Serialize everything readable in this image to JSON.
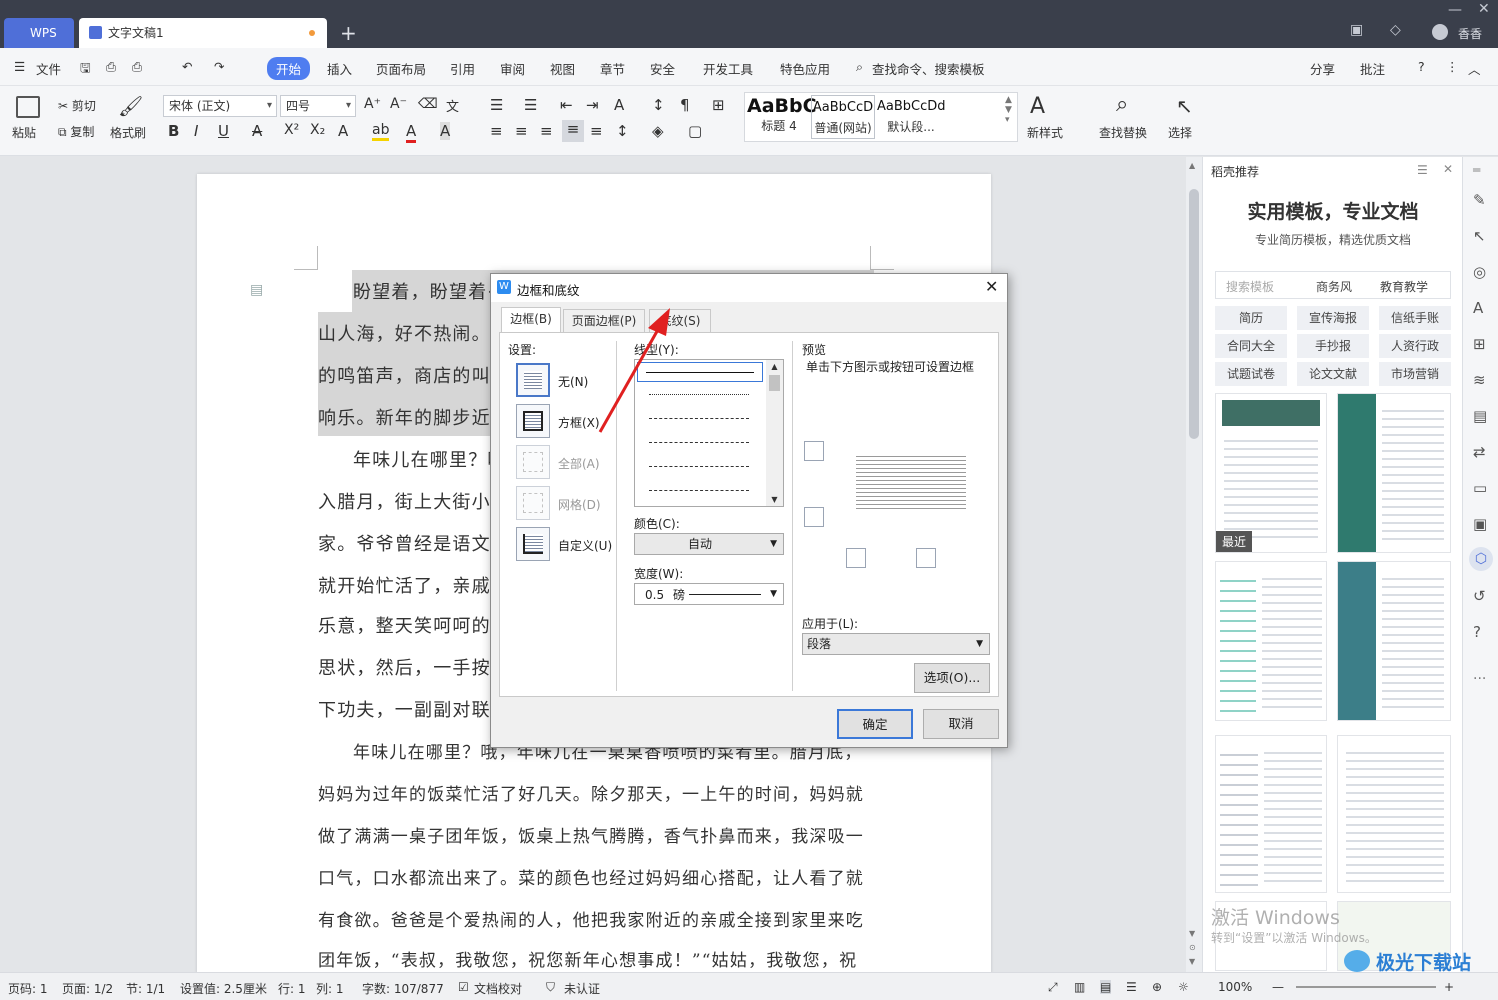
{
  "titlebar": {
    "wps_tab": "WPS",
    "doc_tab": "文字文稿1",
    "new_tab": "+",
    "user": "香香"
  },
  "menubar": {
    "file": "文件",
    "items": [
      "开始",
      "插入",
      "页面布局",
      "引用",
      "审阅",
      "视图",
      "章节",
      "安全",
      "开发工具",
      "特色应用"
    ],
    "search": "查找命令、搜索模板",
    "share": "分享",
    "comment": "批注"
  },
  "ribbon": {
    "paste": "粘贴",
    "cut": "剪切",
    "copy": "复制",
    "format_painter": "格式刷",
    "font_name": "宋体 (正文)",
    "font_size": "四号",
    "styles": [
      {
        "sample": "AaBbC",
        "name": "标题 4"
      },
      {
        "sample": "AaBbCcD",
        "name": "普通(网站)"
      },
      {
        "sample": "AaBbCcDd",
        "name": "默认段..."
      }
    ],
    "new_style": "新样式",
    "find_replace": "查找替换",
    "select": "选择"
  },
  "document": {
    "lines": [
      "盼望着，盼望着·",
      "山人海，好不热闹。眼",
      "的鸣笛声，商店的叫卖",
      "响乐。新年的脚步近",
      "年味儿在哪里？哦",
      "入腊月，街上大街小巷",
      "家。爷爷曾经是语文老",
      "就开始忙活了，亲戚朋",
      "乐意，整天笑呵呵的忙",
      "思状，然后，一手按纸",
      "下功夫，一副副对联就",
      "年味儿在哪里？哦，年味儿在一桌桌香喷喷的菜肴里。腊月底，",
      "妈妈为过年的饭菜忙活了好几天。除夕那天，一上午的时间，妈妈就",
      "做了满满一桌子团年饭，饭桌上热气腾腾，香气扑鼻而来，我深吸一",
      "口气，口水都流出来了。菜的颜色也经过妈妈细心搭配，让人看了就",
      "有食欲。爸爸是个爱热闹的人，他把我家附近的亲戚全接到家里来吃",
      "团年饭，“表叔，我敬您，祝您新年心想事成！”“姑姑，我敬您，祝"
    ]
  },
  "dialog": {
    "title": "边框和底纹",
    "tabs": [
      "边框(B)",
      "页面边框(P)",
      "底纹(S)"
    ],
    "settings_label": "设置:",
    "settings": [
      "无(N)",
      "方框(X)",
      "全部(A)",
      "网格(D)",
      "自定义(U)"
    ],
    "line_style_label": "线型(Y):",
    "color_label": "颜色(C):",
    "color_value": "自动",
    "width_label": "宽度(W):",
    "width_value": "0.5",
    "width_unit": "磅",
    "preview_label": "预览",
    "preview_hint": "单击下方图示或按钮可设置边框",
    "apply_label": "应用于(L):",
    "apply_value": "段落",
    "options_button": "选项(O)...",
    "ok": "确定",
    "cancel": "取消"
  },
  "panel": {
    "header": "稻壳推荐",
    "headline": "实用模板，专业文档",
    "subline": "专业简历模板，精选优质文档",
    "search_placeholder": "搜索模板",
    "chips_top": [
      "商务风",
      "教育教学"
    ],
    "categories": [
      "简历",
      "宣传海报",
      "信纸手账",
      "合同大全",
      "手抄报",
      "人资行政",
      "试题试卷",
      "论文文献",
      "市场营销"
    ],
    "recent_badge": "最近",
    "watermark_line1": "激活 Windows",
    "watermark_line2": "转到“设置”以激活 Windows。"
  },
  "status": {
    "page_code": "页码: 1",
    "page": "页面: 1/2",
    "section": "节: 1/1",
    "setting": "设置值: 2.5厘米",
    "row": "行: 1",
    "col": "列: 1",
    "words": "字数: 107/877",
    "proof": "文档校对",
    "auth": "未认证",
    "zoom": "100%"
  },
  "site_watermark": "极光下载站",
  "colors": {
    "accent": "#4f7df0",
    "titlebar": "#3a3f4b",
    "arrow": "#e02020"
  }
}
